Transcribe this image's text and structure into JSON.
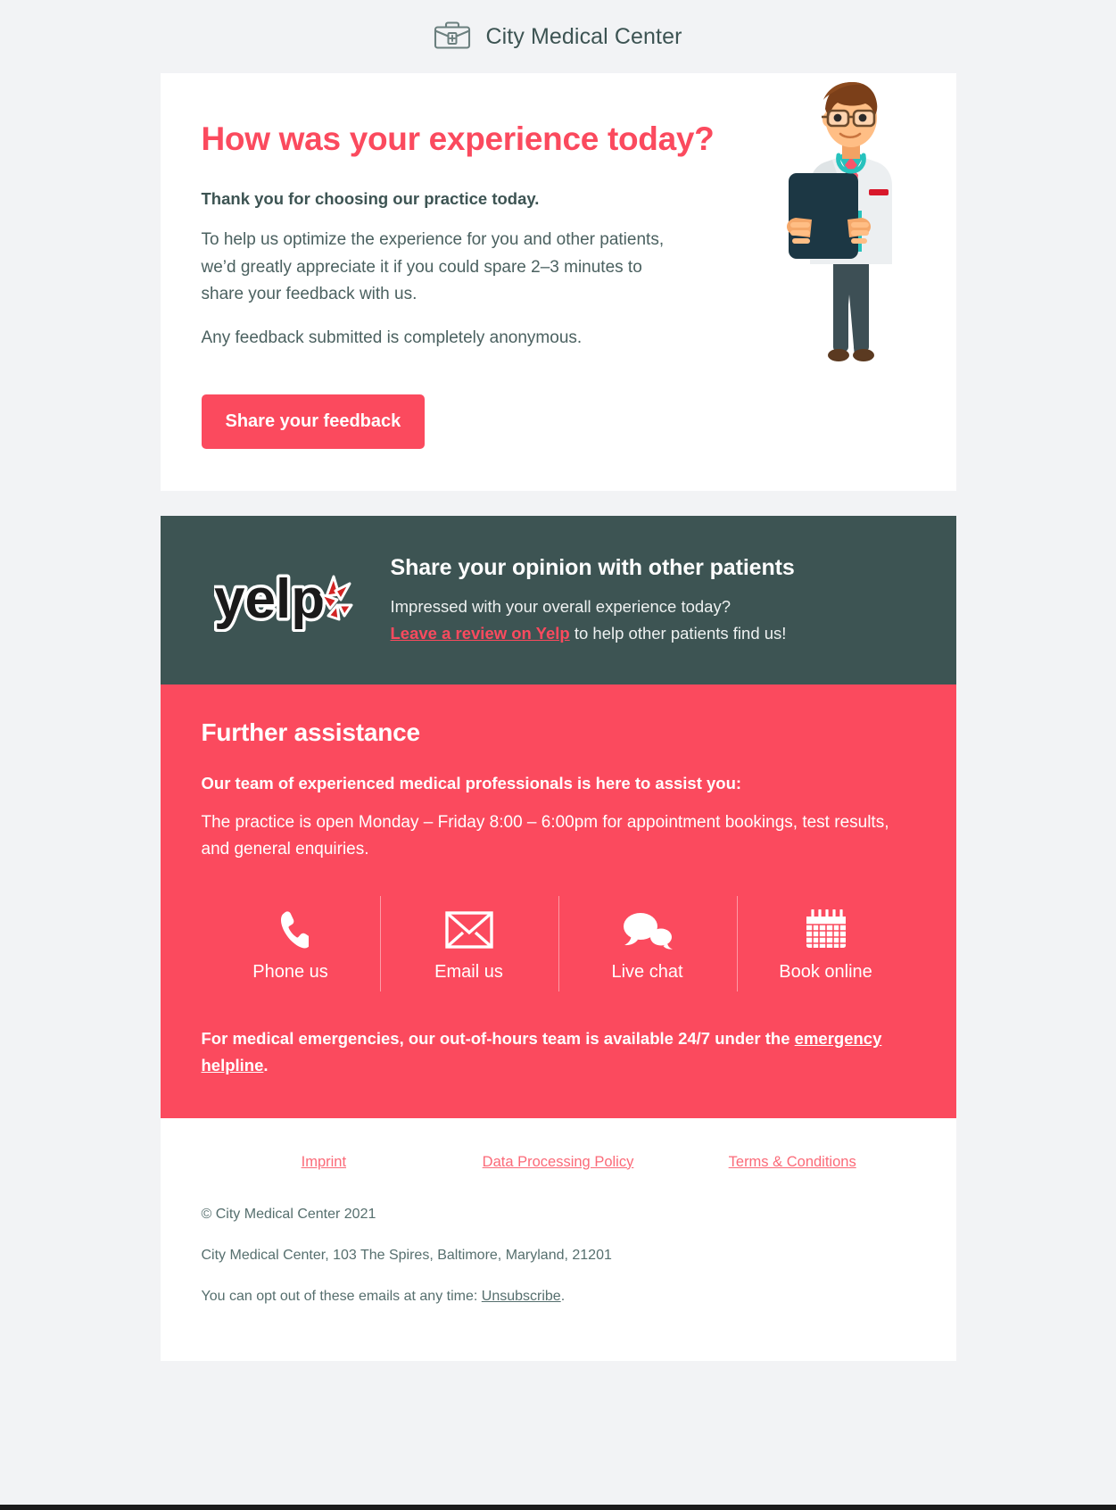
{
  "header": {
    "brand_name": "City Medical Center",
    "brand_icon": "medical-briefcase-icon"
  },
  "hero": {
    "heading": "How was your experience today?",
    "lead": "Thank you for choosing our practice today.",
    "paragraph_1": "To help us optimize the experience for you and other patients, we’d greatly appreciate it if you could spare 2–3 minutes to share your feedback with us.",
    "paragraph_2": "Any feedback submitted is completely anonymous.",
    "cta_label": "Share your feedback",
    "illustration": "doctor-with-clipboard-illustration"
  },
  "yelp": {
    "logo_text": "yelp",
    "heading": "Share your opinion with other patients",
    "line_1": "Impressed with your overall experience today?",
    "link_text": "Leave a review on Yelp",
    "line_2_rest": " to help other patients find us!"
  },
  "assistance": {
    "heading": "Further assistance",
    "subheading": "Our team of experienced medical professionals is here to assist you:",
    "hours": "The practice is open Monday – Friday 8:00 – 6:00pm for appointment bookings, test results, and general enquiries.",
    "contacts": [
      {
        "label": "Phone us",
        "icon": "phone-icon"
      },
      {
        "label": "Email us",
        "icon": "envelope-icon"
      },
      {
        "label": "Live chat",
        "icon": "chat-bubbles-icon"
      },
      {
        "label": "Book online",
        "icon": "calendar-icon"
      }
    ],
    "emergency_prefix": "For medical emergencies, our out-of-hours team is available 24/7 under the ",
    "emergency_link": "emergency helpline",
    "emergency_suffix": "."
  },
  "footer": {
    "links": [
      {
        "label": "Imprint"
      },
      {
        "label": "Data Processing Policy"
      },
      {
        "label": "Terms & Conditions"
      }
    ],
    "copyright": "© City Medical Center 2021",
    "address": "City Medical Center, 103 The Spires, Baltimore, Maryland, 21201",
    "optout_prefix": "You can opt out of these emails at any time: ",
    "optout_link": "Unsubscribe",
    "optout_suffix": "."
  },
  "colors": {
    "accent": "#fb4a5e",
    "dark": "#3d5453",
    "page_bg": "#f2f3f5",
    "card_bg": "#ffffff"
  }
}
